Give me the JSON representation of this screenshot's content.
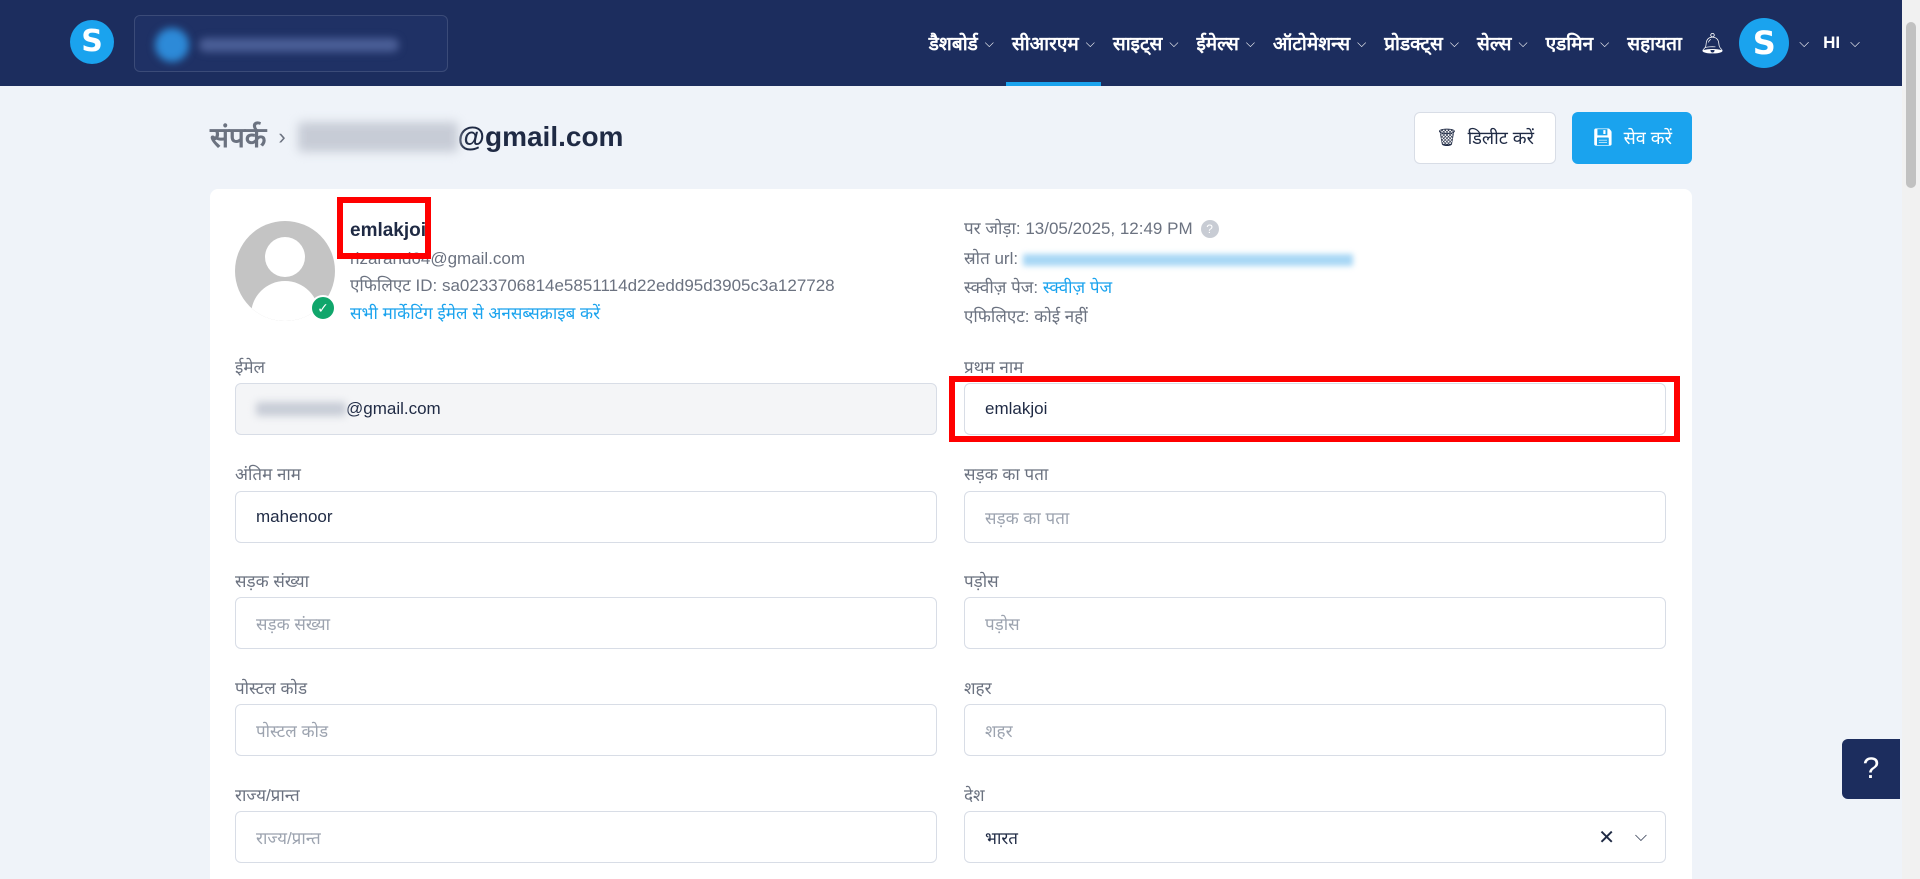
{
  "topbar": {
    "logo_letter": "S",
    "nav_items": [
      {
        "label": "डैशबोर्ड",
        "active": false
      },
      {
        "label": "सीआरएम",
        "active": true
      },
      {
        "label": "साइट्स",
        "active": false
      },
      {
        "label": "ईमेल्स",
        "active": false
      },
      {
        "label": "ऑटोमेशन्स",
        "active": false
      },
      {
        "label": "प्रोडक्ट्स",
        "active": false
      },
      {
        "label": "सेल्स",
        "active": false
      },
      {
        "label": "एडमिन",
        "active": false
      }
    ],
    "help_label": "सहायता",
    "avatar_letter": "S",
    "language": "HI",
    "chevron": "⌄"
  },
  "header": {
    "breadcrumb_root": "संपर्क",
    "breadcrumb_sep": "›",
    "email_suffix": "@gmail.com",
    "delete_label": "डिलीट करें",
    "save_label": "सेव करें"
  },
  "profile": {
    "name": "emlakjoi",
    "email": "rizarand64@gmail.com",
    "affiliate_id": "एफिलिएट ID: sa0233706814e5851114d22edd95d3905c3a127728",
    "unsubscribe": "सभी मार्केटिंग ईमेल से अनसब्सक्राइब करें"
  },
  "meta": {
    "added_label": "पर जोड़ा:",
    "added_value": "13/05/2025, 12:49 PM",
    "source_label": "स्रोत url:",
    "squeeze_label": "स्क्वीज़ पेज:",
    "squeeze_value": "स्क्वीज़ पेज",
    "affiliate_label": "एफिलिएट:",
    "affiliate_value": "कोई नहीं"
  },
  "form": {
    "email_label": "ईमेल",
    "email_suffix": "@gmail.com",
    "first_name_label": "प्रथम नाम",
    "first_name_value": "emlakjoi",
    "last_name_label": "अंतिम नाम",
    "last_name_value": "mahenoor",
    "street_label": "सड़क का पता",
    "street_placeholder": "सड़क का पता",
    "street_no_label": "सड़क संख्या",
    "street_no_placeholder": "सड़क संख्या",
    "neighborhood_label": "पड़ोस",
    "neighborhood_placeholder": "पड़ोस",
    "postal_label": "पोस्टल कोड",
    "postal_placeholder": "पोस्टल कोड",
    "city_label": "शहर",
    "city_placeholder": "शहर",
    "state_label": "राज्य/प्रान्त",
    "state_placeholder": "राज्य/प्रान्त",
    "country_label": "देश",
    "country_value": "भारत"
  },
  "help_fab": "?",
  "colors": {
    "nav_bg": "#1c2d5e",
    "accent": "#1aa3ee",
    "highlight": "#ff0000",
    "verified": "#10a66b"
  }
}
